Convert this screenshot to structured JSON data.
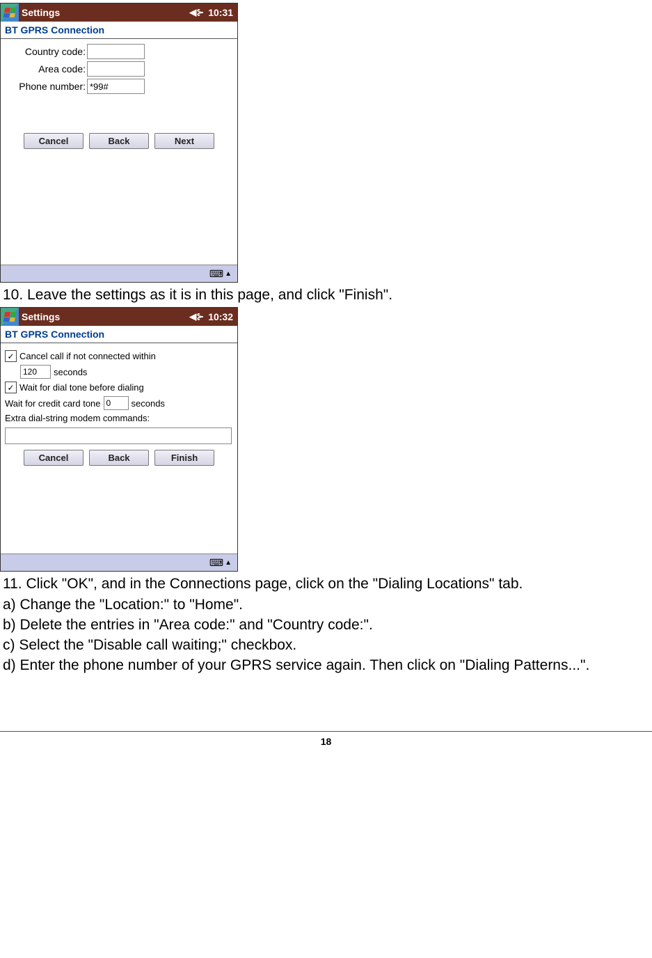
{
  "s1": {
    "app": "Settings",
    "time": "10:31",
    "section": "BT GPRS Connection",
    "country_lbl": "Country code:",
    "country_val": "",
    "area_lbl": "Area code:",
    "area_val": "",
    "phone_lbl": "Phone number:",
    "phone_val": "*99#",
    "cancel": "Cancel",
    "back": "Back",
    "next": "Next"
  },
  "t10": "10. Leave the settings as it is in this page, and click \"Finish\".",
  "s2": {
    "app": "Settings",
    "time": "10:32",
    "section": "BT GPRS Connection",
    "cancel_call": "Cancel call if not connected within",
    "secs_val": "120",
    "seconds": "seconds",
    "wait_dial": "Wait for dial tone before dialing",
    "wait_credit": "Wait for credit card tone",
    "credit_val": "0",
    "extra": "Extra dial-string modem commands:",
    "extra_val": "",
    "cancel": "Cancel",
    "back": "Back",
    "finish": "Finish"
  },
  "t11": "11. Click \"OK\", and in the Connections page, click on the \"Dialing Locations\" tab.",
  "t11a": "a) Change the \"Location:\" to \"Home\".",
  "t11b": "b) Delete the entries in \"Area code:\" and \"Country code:\".",
  "t11c": "c) Select the \"Disable call waiting;\" checkbox.",
  "t11d": "d) Enter the phone number of your GPRS service again. Then click on \"Dialing Patterns...\".",
  "pg": "18"
}
